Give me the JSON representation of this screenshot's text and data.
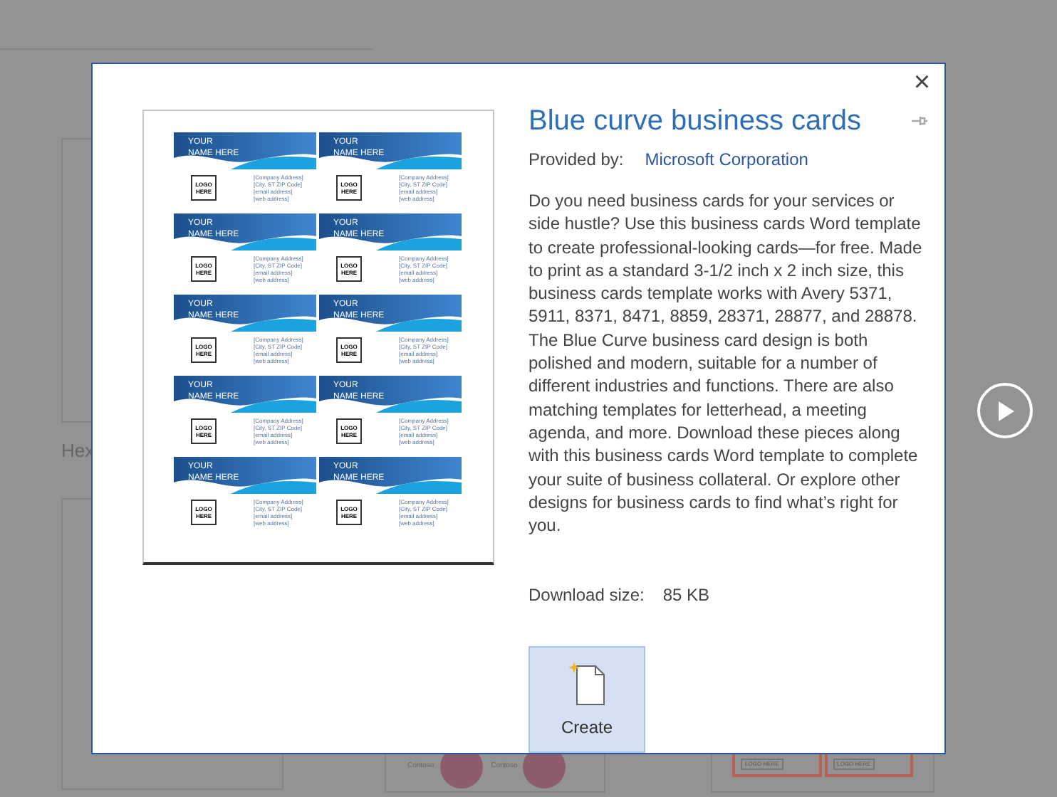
{
  "background": {
    "gallery_label": "Hex",
    "logo_texts": [
      "Contoso",
      "Contoso"
    ],
    "logo_here": [
      "LOGO HERE",
      "LOGO HERE"
    ]
  },
  "dialog": {
    "title": "Blue curve business cards",
    "provided_by_label": "Provided by:",
    "provider": "Microsoft Corporation",
    "description": "Do you need business cards for your services or side hustle? Use this business cards Word template to create professional-looking cards—for free. Made to print as a standard 3-1/2 inch x 2 inch size, this business cards template works with Avery 5371, 5911, 8371, 8471, 8859, 28371, 28877, and 28878. The Blue Curve business card design is both polished and modern, suitable for a number of different industries and functions. There are also matching templates for letterhead, a meeting agenda, and more. Download these pieces along with this business cards Word template to complete your suite of business collateral. Or explore other designs for business cards to find what’s right for you.",
    "download_label": "Download size:",
    "download_size": "85 KB",
    "create_label": "Create",
    "close": "×",
    "preview_cards": [
      {
        "name_line_1": "YOUR",
        "name_line_2": "NAME HERE",
        "logo": "LOGO HERE",
        "address_lines": [
          "[Company Address]",
          "[City, ST ZIP Code]",
          "[email address]",
          "[web address]"
        ]
      },
      {
        "name_line_1": "YOUR",
        "name_line_2": "NAME HERE",
        "logo": "LOGO HERE",
        "address_lines": [
          "[Company Address]",
          "[City, ST ZIP Code]",
          "[email address]",
          "[web address]"
        ]
      },
      {
        "name_line_1": "YOUR",
        "name_line_2": "NAME HERE",
        "logo": "LOGO HERE",
        "address_lines": [
          "[Company Address]",
          "[City, ST ZIP Code]",
          "[email address]",
          "[web address]"
        ]
      },
      {
        "name_line_1": "YOUR",
        "name_line_2": "NAME HERE",
        "logo": "LOGO HERE",
        "address_lines": [
          "[Company Address]",
          "[City, ST ZIP Code]",
          "[email address]",
          "[web address]"
        ]
      },
      {
        "name_line_1": "YOUR",
        "name_line_2": "NAME HERE",
        "logo": "LOGO HERE",
        "address_lines": [
          "[Company Address]",
          "[City, ST ZIP Code]",
          "[email address]",
          "[web address]"
        ]
      },
      {
        "name_line_1": "YOUR",
        "name_line_2": "NAME HERE",
        "logo": "LOGO HERE",
        "address_lines": [
          "[Company Address]",
          "[City, ST ZIP Code]",
          "[email address]",
          "[web address]"
        ]
      },
      {
        "name_line_1": "YOUR",
        "name_line_2": "NAME HERE",
        "logo": "LOGO HERE",
        "address_lines": [
          "[Company Address]",
          "[City, ST ZIP Code]",
          "[email address]",
          "[web address]"
        ]
      },
      {
        "name_line_1": "YOUR",
        "name_line_2": "NAME HERE",
        "logo": "LOGO HERE",
        "address_lines": [
          "[Company Address]",
          "[City, ST ZIP Code]",
          "[email address]",
          "[web address]"
        ]
      },
      {
        "name_line_1": "YOUR",
        "name_line_2": "NAME HERE",
        "logo": "LOGO HERE",
        "address_lines": [
          "[Company Address]",
          "[City, ST ZIP Code]",
          "[email address]",
          "[web address]"
        ]
      },
      {
        "name_line_1": "YOUR",
        "name_line_2": "NAME HERE",
        "logo": "LOGO HERE",
        "address_lines": [
          "[Company Address]",
          "[City, ST ZIP Code]",
          "[email address]",
          "[web address]"
        ]
      }
    ]
  }
}
